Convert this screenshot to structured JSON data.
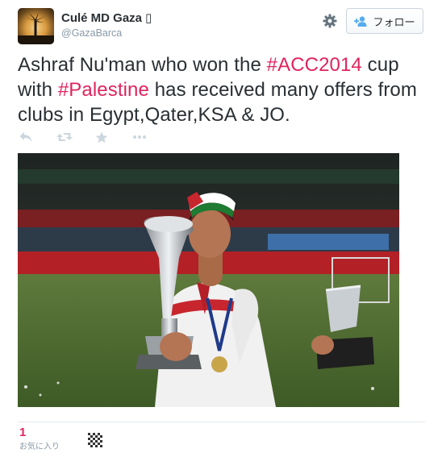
{
  "user": {
    "display_name": "Culé MD Gaza",
    "name_suffix": "▯",
    "screen_name": "@GazaBarca"
  },
  "follow_button": {
    "label": "フォロー"
  },
  "tweet": {
    "segments": [
      {
        "text": "Ashraf Nu'man who won the ",
        "kind": "text"
      },
      {
        "text": "#ACC2014",
        "kind": "hashtag"
      },
      {
        "text": " cup with ",
        "kind": "text"
      },
      {
        "text": "#Palestine",
        "kind": "hashtag"
      },
      {
        "text": " has received many offers from clubs in Egypt,Qater,KSA & JO.",
        "kind": "text"
      }
    ]
  },
  "actions": [
    {
      "name": "reply-icon"
    },
    {
      "name": "retweet-icon"
    },
    {
      "name": "favorite-icon"
    },
    {
      "name": "more-icon"
    }
  ],
  "stats": {
    "favorites_count": "1",
    "favorites_label": "お気に入り"
  },
  "colors": {
    "hashtag": "#e0245e",
    "muted": "#8899a6",
    "text": "#292f33"
  }
}
